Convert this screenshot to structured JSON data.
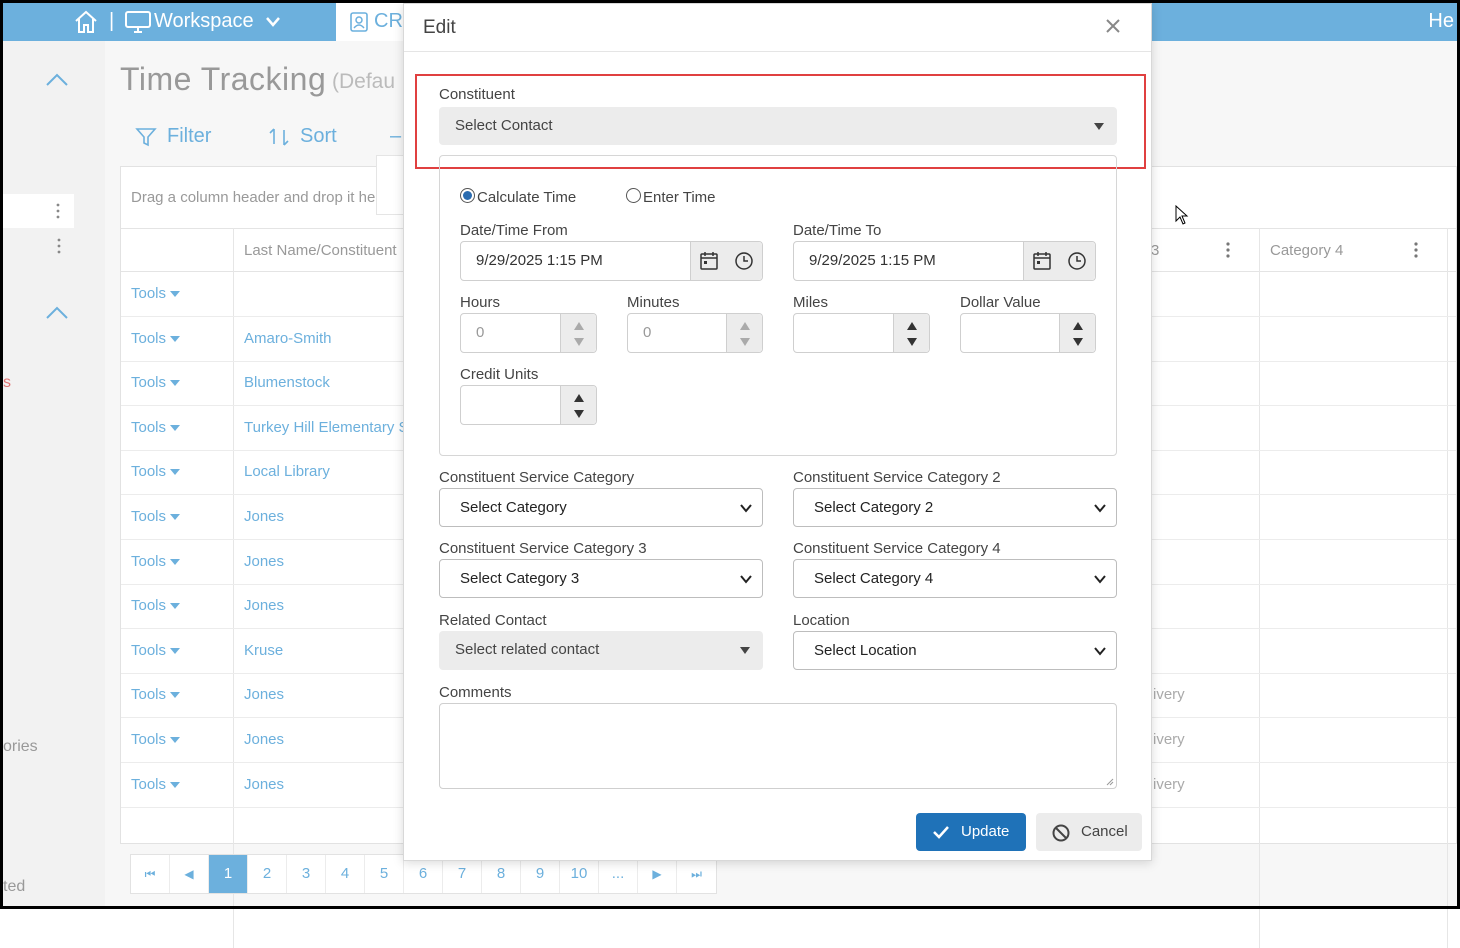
{
  "topbar": {
    "workspace_label": "Workspace",
    "tab_label": "CR",
    "right_label": "He"
  },
  "leftrail": {
    "red_fragment": "s",
    "categories_fragment": "ories",
    "bottom_fragment": "ted"
  },
  "page": {
    "title": "Time Tracking",
    "subtitle": "(Defau",
    "filter_label": "Filter",
    "sort_label": "Sort",
    "dash": "–",
    "group_hint": "Drag a column header and drop it her"
  },
  "grid": {
    "headers": {
      "last_name": "Last Name/Constituent",
      "cat3_fragment": "3",
      "cat4": "Category 4"
    },
    "rows": [
      {
        "tools": "Tools",
        "name": "",
        "cat3": ""
      },
      {
        "tools": "Tools",
        "name": "Amaro-Smith",
        "cat3": ""
      },
      {
        "tools": "Tools",
        "name": "Blumenstock",
        "cat3": ""
      },
      {
        "tools": "Tools",
        "name": "Turkey Hill Elementary S",
        "cat3": ""
      },
      {
        "tools": "Tools",
        "name": "Local Library",
        "cat3": ""
      },
      {
        "tools": "Tools",
        "name": "Jones",
        "cat3": ""
      },
      {
        "tools": "Tools",
        "name": "Jones",
        "cat3": ""
      },
      {
        "tools": "Tools",
        "name": "Jones",
        "cat3": ""
      },
      {
        "tools": "Tools",
        "name": "Kruse",
        "cat3": ""
      },
      {
        "tools": "Tools",
        "name": "Jones",
        "cat3": "ivery"
      },
      {
        "tools": "Tools",
        "name": "Jones",
        "cat3": "ivery"
      },
      {
        "tools": "Tools",
        "name": "Jones",
        "cat3": "ivery"
      }
    ],
    "pages": [
      "1",
      "2",
      "3",
      "4",
      "5",
      "6",
      "7",
      "8",
      "9",
      "10",
      "..."
    ],
    "current_page": "1"
  },
  "modal": {
    "title": "Edit",
    "constituent_label": "Constituent",
    "constituent_value": "Select Contact",
    "calc_time_label": "Calculate Time",
    "enter_time_label": "Enter Time",
    "selected_mode": "calculate",
    "from_label": "Date/Time From",
    "from_value": "9/29/2025 1:15 PM",
    "to_label": "Date/Time To",
    "to_value": "9/29/2025 1:15 PM",
    "hours_label": "Hours",
    "hours_value": "0",
    "minutes_label": "Minutes",
    "minutes_value": "0",
    "miles_label": "Miles",
    "miles_value": "",
    "dollar_label": "Dollar Value",
    "dollar_value": "",
    "credit_label": "Credit Units",
    "credit_value": "",
    "cat1_label": "Constituent Service Category",
    "cat1_value": "Select Category",
    "cat2_label": "Constituent Service Category 2",
    "cat2_value": "Select Category 2",
    "cat3_label": "Constituent Service Category 3",
    "cat3_value": "Select Category 3",
    "cat4_label": "Constituent Service Category 4",
    "cat4_value": "Select Category 4",
    "related_label": "Related Contact",
    "related_value": "Select related contact",
    "location_label": "Location",
    "location_value": "Select Location",
    "comments_label": "Comments",
    "comments_value": "",
    "update_label": "Update",
    "cancel_label": "Cancel"
  },
  "colors": {
    "accent": "#6cb0dd",
    "primary_button": "#1f72b8",
    "highlight": "#e04040"
  },
  "icons": [
    "home-icon",
    "monitor-icon",
    "chevron-down-icon",
    "contact-card-icon",
    "filter-icon",
    "sort-icon",
    "close-icon",
    "calendar-icon",
    "clock-icon",
    "check-icon",
    "ban-icon",
    "cursor-icon",
    "kebab-icon"
  ]
}
